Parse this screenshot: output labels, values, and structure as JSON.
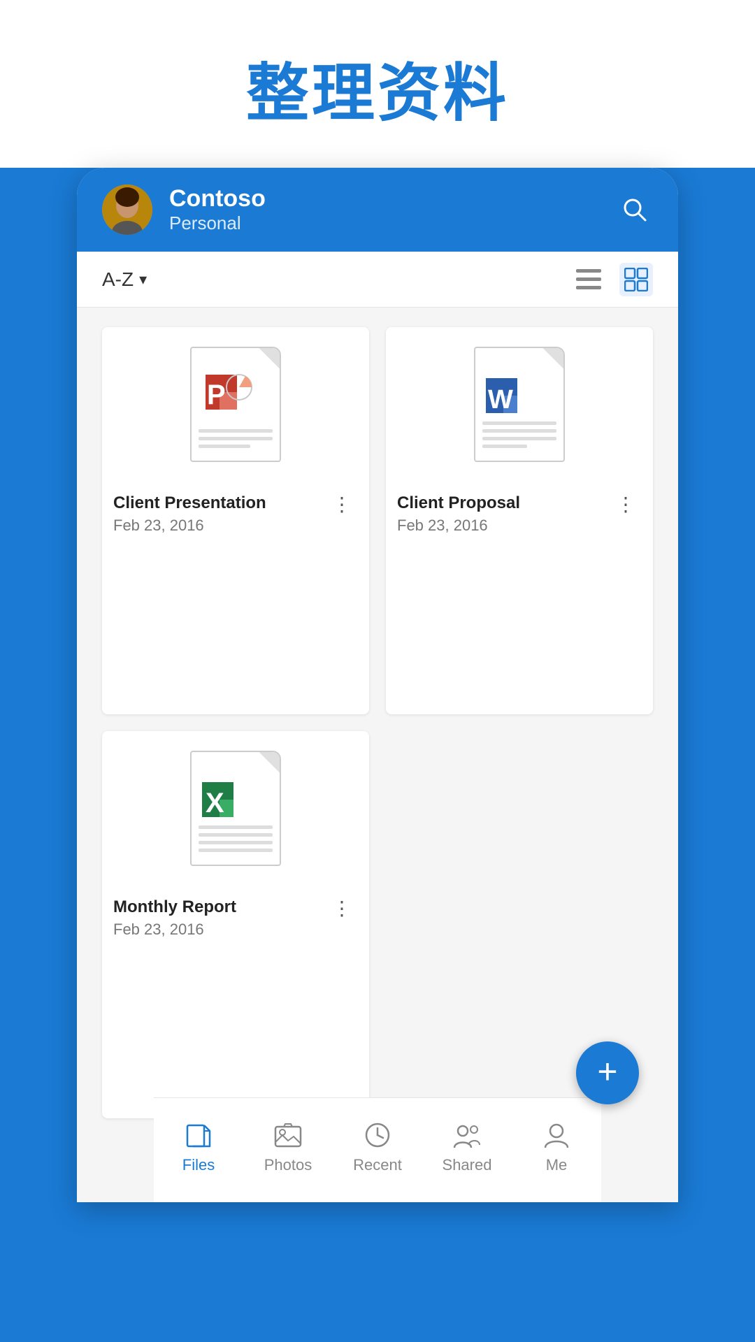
{
  "page": {
    "title": "整理资料",
    "background_color": "#1a7ad4"
  },
  "header": {
    "user_name": "Contoso",
    "user_sub": "Personal",
    "search_label": "search"
  },
  "toolbar": {
    "sort_label": "A-Z",
    "sort_icon": "▾"
  },
  "files": [
    {
      "name": "Client Presentation",
      "date": "Feb 23, 2016",
      "type": "ppt",
      "app_color": "#c0392b",
      "app_letter": "P"
    },
    {
      "name": "Client Proposal",
      "date": "Feb 23, 2016",
      "type": "word",
      "app_color": "#2b5fad",
      "app_letter": "W"
    },
    {
      "name": "Monthly Report",
      "date": "Feb 23, 2016",
      "type": "excel",
      "app_color": "#1e7e45",
      "app_letter": "X"
    }
  ],
  "fab": {
    "label": "+"
  },
  "bottom_nav": {
    "items": [
      {
        "id": "files",
        "label": "Files",
        "active": true
      },
      {
        "id": "photos",
        "label": "Photos",
        "active": false
      },
      {
        "id": "recent",
        "label": "Recent",
        "active": false
      },
      {
        "id": "shared",
        "label": "Shared",
        "active": false
      },
      {
        "id": "me",
        "label": "Me",
        "active": false
      }
    ]
  }
}
